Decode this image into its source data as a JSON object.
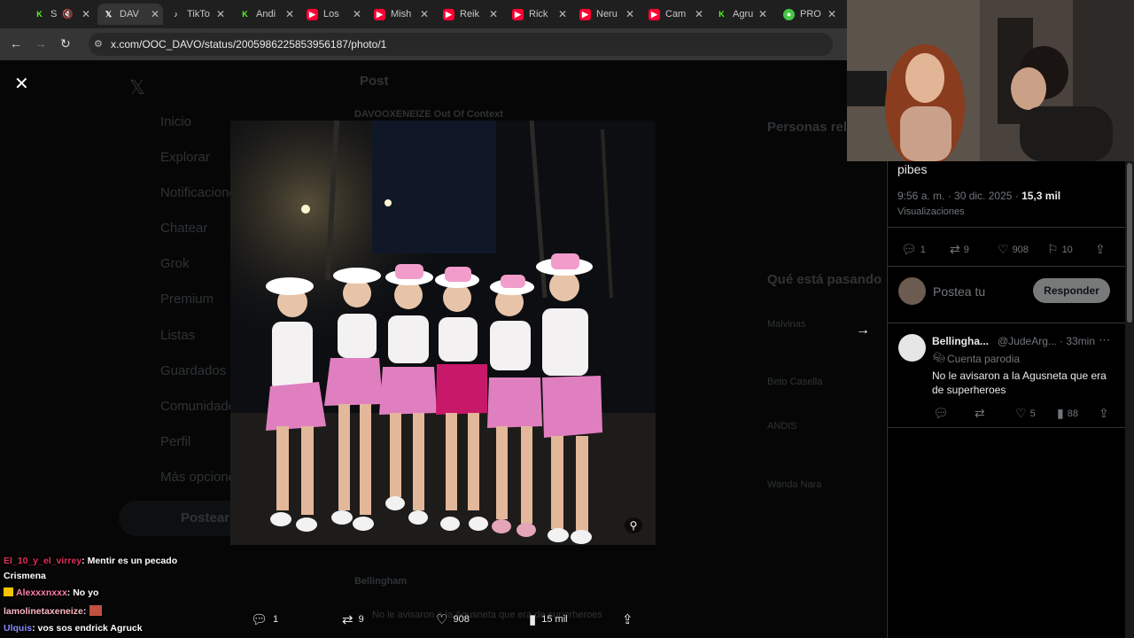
{
  "browser": {
    "tabs": [
      {
        "label": "S",
        "icon": "kick-icon",
        "color": "#53fc18"
      },
      {
        "label": "DAV",
        "icon": "x-icon",
        "color": "#ffffff",
        "active": true
      },
      {
        "label": "TikTo",
        "icon": "tiktok-icon",
        "color": "#ffffff"
      },
      {
        "label": "Andi",
        "icon": "kick-icon",
        "color": "#53fc18"
      },
      {
        "label": "Los ",
        "icon": "youtube-icon",
        "color": "#ff0033"
      },
      {
        "label": "Mish",
        "icon": "youtube-icon",
        "color": "#ff0033"
      },
      {
        "label": "Reik",
        "icon": "youtube-icon",
        "color": "#ff0033"
      },
      {
        "label": "Rick",
        "icon": "youtube-icon",
        "color": "#ff0033"
      },
      {
        "label": "Neru",
        "icon": "youtube-icon",
        "color": "#ff0033"
      },
      {
        "label": "Cam",
        "icon": "youtube-icon",
        "color": "#ff0033"
      },
      {
        "label": "Agru",
        "icon": "kick-icon",
        "color": "#53fc18"
      },
      {
        "label": "PRO",
        "icon": "green-globe-icon",
        "color": "#44c744"
      }
    ],
    "url": "x.com/OOC_DAVO/status/2005986225853956187/photo/1"
  },
  "background": {
    "nav": [
      "Inicio",
      "Explorar",
      "Notificaciones",
      "Chatear",
      "Grok",
      "Premium",
      "Listas",
      "Guardados",
      "Comunidades",
      "Perfil",
      "Más opciones"
    ],
    "post_header": "Post",
    "account": "DAVOOXENEIZE Out Of Context",
    "post_button": "Postear",
    "personas": "Personas relevantes",
    "trending_title": "Qué está pasando",
    "trends": [
      "Malvinas",
      "Beto Casella",
      "ANDIS",
      "Wanda Nara"
    ],
    "reply_name": "Bellingham",
    "reply_text": "No le avisaron a la Agusneta que era de superheroes"
  },
  "photo_actions": {
    "replies": "1",
    "reposts": "9",
    "likes": "908",
    "views": "15 mil"
  },
  "post": {
    "text_tail": "pibes",
    "time": "9:56 a. m. · 30 dic. 2025 · ",
    "views_count": "15,3 mil",
    "views_label": "Visualizaciones",
    "replies": "1",
    "reposts": "9",
    "likes": "908",
    "bookmarks": "10"
  },
  "composer": {
    "placeholder": "Postea tu respuesta",
    "reply_button": "Responder"
  },
  "reply": {
    "name": "Bellingha...",
    "handle": "@JudeArg...",
    "time": "· 33min",
    "badge": "Cuenta parodia",
    "text": "No le avisaron a la Agusneta que era de superheroes",
    "replies": "",
    "reposts": "",
    "likes": "5",
    "views": "88"
  },
  "chat": [
    {
      "user": "El_10_y_el_virrey",
      "msg": ": Mentir es un pecado"
    },
    {
      "user": "",
      "msg": "Crismena"
    },
    {
      "user": "Alexxxnxxx",
      "msg": ": No yo"
    },
    {
      "user": "lamolinetaxeneize",
      "msg": ":"
    },
    {
      "user": "Ulquis",
      "msg": ": vos sos endrick Agruck"
    }
  ]
}
